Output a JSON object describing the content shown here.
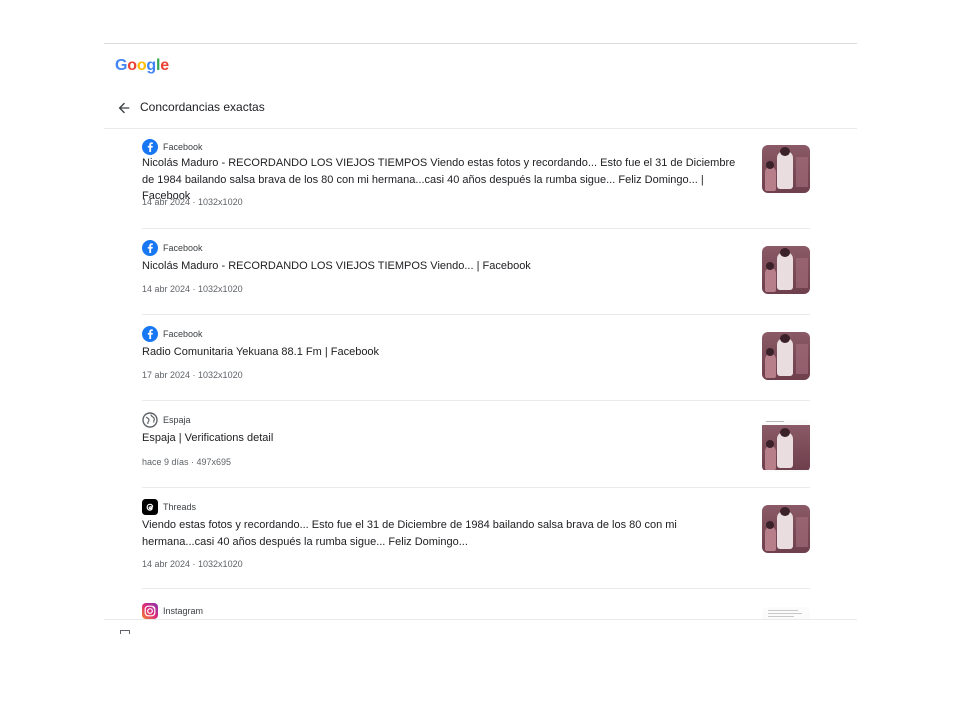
{
  "logo": {
    "letters": [
      "G",
      "o",
      "o",
      "g",
      "l",
      "e"
    ]
  },
  "header": {
    "title": "Concordancias exactas"
  },
  "results": [
    {
      "source": "Facebook",
      "icon": "facebook-icon",
      "title": "Nicolás Maduro - RECORDANDO LOS VIEJOS TIEMPOS Viendo estas fotos y recordando... Esto fue el 31 de Diciembre de 1984 bailando salsa brava de los 80 con mi hermana...casi 40 años después la rumba sigue... Feliz Domingo... | Facebook",
      "meta": "14 abr 2024 · 1032x1020"
    },
    {
      "source": "Facebook",
      "icon": "facebook-icon",
      "title": "Nicolás Maduro - RECORDANDO LOS VIEJOS TIEMPOS Viendo... | Facebook",
      "meta": "14 abr 2024 · 1032x1020"
    },
    {
      "source": "Facebook",
      "icon": "facebook-icon",
      "title": "Radio Comunitaria Yekuana 88.1 Fm | Facebook",
      "meta": "17 abr 2024 · 1032x1020"
    },
    {
      "source": "Espaja",
      "icon": "globe-icon",
      "title": "Espaja | Verifications detail",
      "meta": "hace 9 días · 497x695"
    },
    {
      "source": "Threads",
      "icon": "threads-icon",
      "title": "Viendo estas fotos y recordando... Esto fue el 31 de Diciembre de 1984 bailando salsa brava de los 80 con mi hermana...casi 40 años después la rumba sigue... Feliz Domingo...",
      "meta": "14 abr 2024 · 1032x1020"
    },
    {
      "source": "Instagram",
      "icon": "instagram-icon",
      "title": "",
      "meta": ""
    }
  ],
  "colors": {
    "facebook": "#1877F2",
    "globe": "#5f6368",
    "threads": "#000000",
    "instagram_start": "#F58529",
    "instagram_mid": "#DD2A7B",
    "instagram_end": "#8134AF"
  }
}
